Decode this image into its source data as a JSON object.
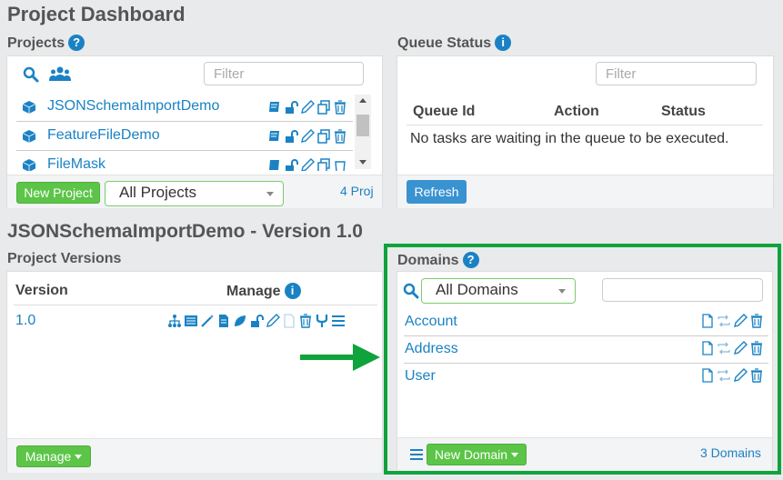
{
  "page": {
    "title": "Project Dashboard"
  },
  "projects": {
    "heading": "Projects",
    "filter_placeholder": "Filter",
    "items": [
      {
        "name": "JSONSchemaImportDemo"
      },
      {
        "name": "FeatureFileDemo"
      },
      {
        "name": "FileMask"
      }
    ],
    "new_button": "New Project",
    "select_value": "All Projects",
    "count": "4 Proj"
  },
  "queue": {
    "heading": "Queue Status",
    "filter_placeholder": "Filter",
    "columns": [
      "Queue Id",
      "Action",
      "Status"
    ],
    "empty_message": "No tasks are waiting in the queue to be executed.",
    "refresh_button": "Refresh"
  },
  "project_detail": {
    "title": "JSONSchemaImportDemo - Version 1.0"
  },
  "versions": {
    "heading": "Project Versions",
    "col_version": "Version",
    "col_manage": "Manage",
    "rows": [
      {
        "version": "1.0"
      }
    ],
    "manage_button": "Manage"
  },
  "domains": {
    "heading": "Domains",
    "select_value": "All Domains",
    "search_value": "",
    "items": [
      {
        "name": "Account"
      },
      {
        "name": "Address"
      },
      {
        "name": "User"
      }
    ],
    "new_button": "New Domain",
    "count": "3 Domains"
  },
  "colors": {
    "link": "#1a82c4",
    "green": "#5cc548",
    "highlight_border": "#0fa33c",
    "arrow": "#0fa33c"
  }
}
